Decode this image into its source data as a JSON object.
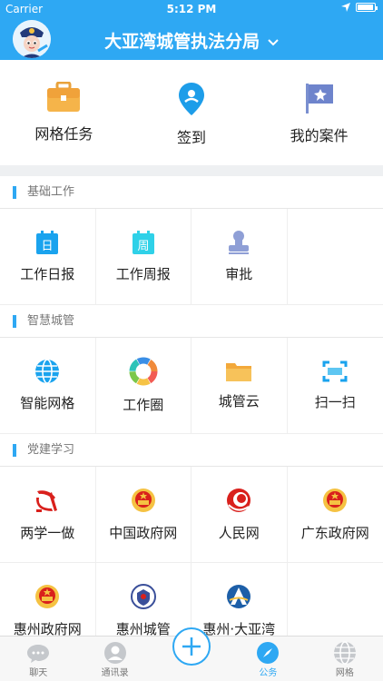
{
  "status": {
    "carrier": "Carrier",
    "time": "5:12 PM"
  },
  "header": {
    "title": "大亚湾城管执法分局",
    "chevron": "chevron-down-icon"
  },
  "quick": [
    {
      "label": "网格任务",
      "icon": "briefcase-icon"
    },
    {
      "label": "签到",
      "icon": "location-pin-icon"
    },
    {
      "label": "我的案件",
      "icon": "badge-flag-icon"
    }
  ],
  "sections": [
    {
      "title": "基础工作",
      "items": [
        {
          "label": "工作日报",
          "icon": "calendar-day-icon",
          "glyph": "日"
        },
        {
          "label": "工作周报",
          "icon": "calendar-week-icon",
          "glyph": "周"
        },
        {
          "label": "审批",
          "icon": "stamp-icon"
        }
      ]
    },
    {
      "title": "智慧城管",
      "items": [
        {
          "label": "智能网格",
          "icon": "globe-icon"
        },
        {
          "label": "工作圈",
          "icon": "color-wheel-icon"
        },
        {
          "label": "城管云",
          "icon": "folder-icon"
        },
        {
          "label": "扫一扫",
          "icon": "scan-icon"
        }
      ]
    },
    {
      "title": "党建学习",
      "items": [
        {
          "label": "两学一做",
          "icon": "party-emblem-icon"
        },
        {
          "label": "中国政府网",
          "icon": "national-emblem-icon"
        },
        {
          "label": "人民网",
          "icon": "people-logo-icon"
        },
        {
          "label": "广东政府网",
          "icon": "national-emblem-icon"
        },
        {
          "label": "惠州政府网",
          "icon": "national-emblem-icon"
        },
        {
          "label": "惠州城管",
          "icon": "city-management-badge-icon"
        },
        {
          "label": "惠州·大亚湾",
          "icon": "dayawan-logo-icon"
        }
      ]
    }
  ],
  "tabs": [
    {
      "label": "聊天",
      "icon": "chat-icon",
      "active": false
    },
    {
      "label": "通讯录",
      "icon": "contacts-icon",
      "active": false
    },
    {
      "label": "",
      "icon": "plus-icon",
      "active": false
    },
    {
      "label": "公务",
      "icon": "compass-icon",
      "active": true
    },
    {
      "label": "网格",
      "icon": "grid-globe-icon",
      "active": false
    }
  ],
  "colors": {
    "primary": "#2ea8f3",
    "party_red": "#d9201c",
    "gold": "#f5c242"
  }
}
